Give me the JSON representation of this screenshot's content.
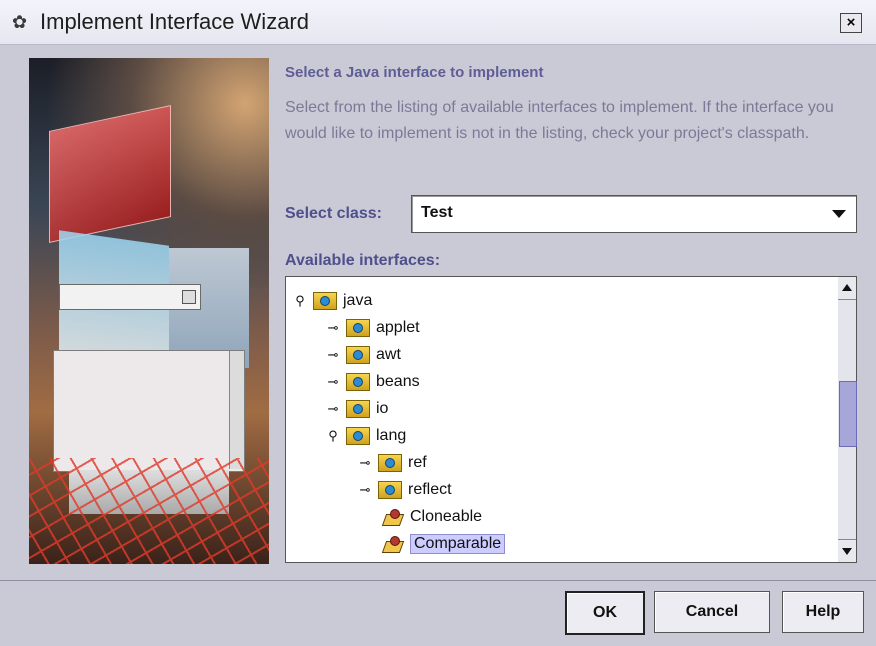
{
  "window": {
    "title": "Implement Interface Wizard",
    "close_label": "×"
  },
  "content": {
    "heading": "Select a Java interface to implement",
    "description": "Select from the listing of available interfaces to implement. If the interface you would like to implement is not in the listing, check your project's classpath.",
    "select_class_label": "Select class:",
    "select_class_value": "Test",
    "available_label": "Available interfaces:"
  },
  "tree": {
    "items": [
      {
        "label": "java",
        "handle": "⚲"
      },
      {
        "label": "applet",
        "handle": "⊸"
      },
      {
        "label": "awt",
        "handle": "⊸"
      },
      {
        "label": "beans",
        "handle": "⊸"
      },
      {
        "label": "io",
        "handle": "⊸"
      },
      {
        "label": "lang",
        "handle": "⚲"
      },
      {
        "label": "ref",
        "handle": "⊸"
      },
      {
        "label": "reflect",
        "handle": "⊸"
      },
      {
        "label": "Cloneable"
      },
      {
        "label": "Comparable",
        "selected": true
      }
    ]
  },
  "buttons": {
    "ok": "OK",
    "cancel": "Cancel",
    "help": "Help"
  },
  "colors": {
    "accent_text": "#5e5d95",
    "selection": "#ccccff",
    "scroll_thumb": "#a6a6d9"
  }
}
